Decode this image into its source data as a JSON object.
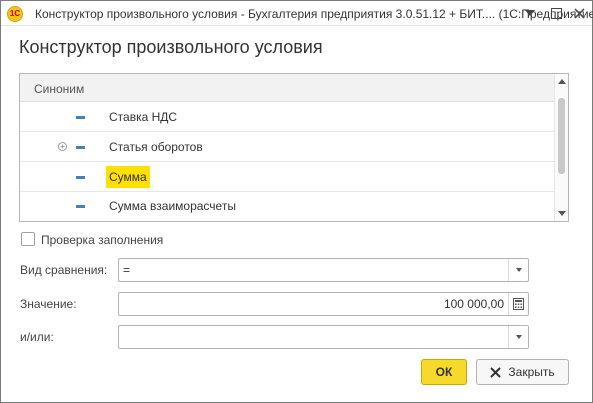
{
  "window": {
    "title": "Конструктор произвольного условия - Бухгалтерия предприятия 3.0.51.12 + БИТ.... (1С:Предприятие)",
    "app_icon_text": "1С"
  },
  "form": {
    "heading": "Конструктор произвольного условия"
  },
  "list": {
    "column_header": "Синоним",
    "rows": [
      {
        "label": "Ставка НДС",
        "expandable": false,
        "selected": false
      },
      {
        "label": "Статья оборотов",
        "expandable": true,
        "selected": false
      },
      {
        "label": "Сумма",
        "expandable": false,
        "selected": true
      },
      {
        "label": "Сумма взаиморасчеты",
        "expandable": false,
        "selected": false
      }
    ]
  },
  "fill_check": {
    "label": "Проверка заполнения",
    "checked": false
  },
  "fields": {
    "comparison": {
      "label": "Вид сравнения:",
      "value": "="
    },
    "value": {
      "label": "Значение:",
      "value": "100 000,00"
    },
    "andor": {
      "label": "и/или:",
      "value": ""
    }
  },
  "buttons": {
    "ok": "ОК",
    "close": "Закрыть"
  },
  "colors": {
    "selection": "#ffe000",
    "ok_button": "#f6d92a",
    "marker": "#4a7ebf"
  }
}
